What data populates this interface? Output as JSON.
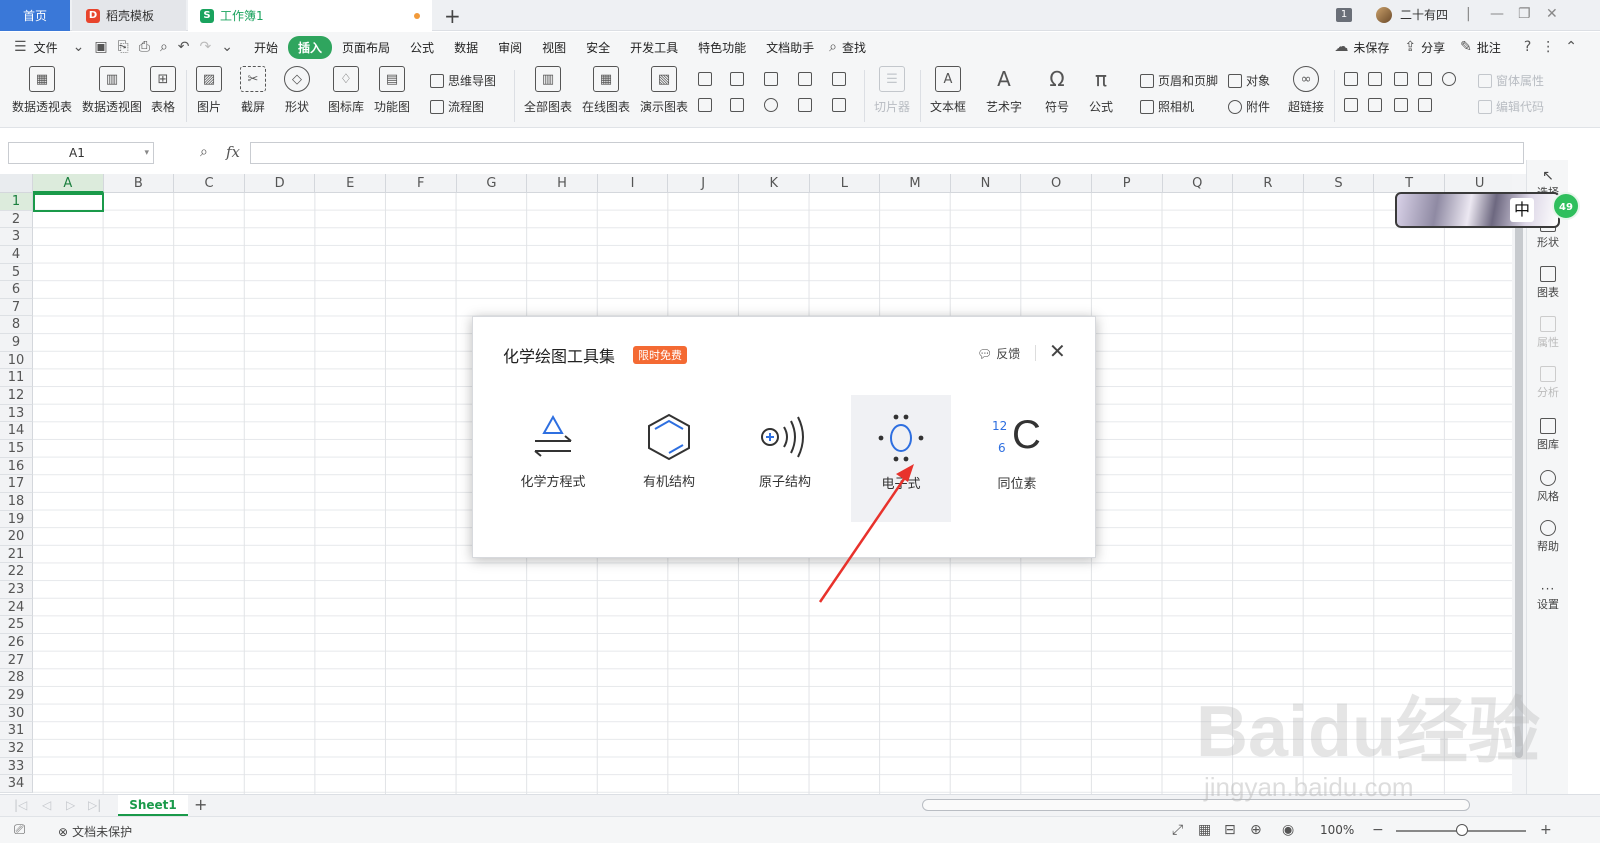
{
  "tabs": {
    "home": "首页",
    "template": "稻壳模板",
    "workbook": "工作簿1",
    "new_tab": "+"
  },
  "titlebar": {
    "count": "1",
    "user": "二十有四"
  },
  "menu": {
    "file": "文件",
    "items": [
      "开始",
      "插入",
      "页面布局",
      "公式",
      "数据",
      "审阅",
      "视图",
      "安全",
      "开发工具",
      "特色功能",
      "文档助手"
    ],
    "active": "插入",
    "search": "查找",
    "unsaved": "未保存",
    "share": "分享",
    "comment": "批注"
  },
  "ribbon": {
    "pivot_table": "数据透视表",
    "pivot_chart": "数据透视图",
    "table": "表格",
    "picture": "图片",
    "screenshot": "截屏",
    "shape": "形状",
    "icon_lib": "图标库",
    "func_chart": "功能图",
    "mind_map": "思维导图",
    "flow_chart": "流程图",
    "all_charts": "全部图表",
    "online_chart": "在线图表",
    "demo_chart": "演示图表",
    "slicer": "切片器",
    "textbox": "文本框",
    "wordart": "艺术字",
    "symbol": "符号",
    "formula": "公式",
    "header_footer": "页眉和页脚",
    "object": "对象",
    "camera": "照相机",
    "attachment": "附件",
    "hyperlink": "超链接",
    "form_props": "窗体属性",
    "edit_code": "编辑代码"
  },
  "formula_bar": {
    "cell_ref": "A1",
    "fx": "fx",
    "value": ""
  },
  "grid": {
    "columns": [
      "A",
      "B",
      "C",
      "D",
      "E",
      "F",
      "G",
      "H",
      "I",
      "J",
      "K",
      "L",
      "M",
      "N",
      "O",
      "P",
      "Q",
      "R",
      "S",
      "T",
      "U"
    ],
    "rows": [
      "1",
      "2",
      "3",
      "4",
      "5",
      "6",
      "7",
      "8",
      "9",
      "10",
      "11",
      "12",
      "13",
      "14",
      "15",
      "16",
      "17",
      "18",
      "19",
      "20",
      "21",
      "22",
      "23",
      "24",
      "25",
      "26",
      "27",
      "28",
      "29",
      "30",
      "31",
      "32",
      "33",
      "34"
    ],
    "selected_cell": "A1"
  },
  "right_panel": {
    "select": "选择",
    "shape": "形状",
    "chart": "图表",
    "property": "属性",
    "analysis": "分析",
    "gallery": "图库",
    "style": "风格",
    "help": "帮助",
    "settings": "设置"
  },
  "ime": {
    "char": "中",
    "badge": "49"
  },
  "dialog": {
    "title": "化学绘图工具集",
    "badge": "限时免费",
    "feedback": "反馈",
    "tools": [
      {
        "label": "化学方程式",
        "icon": "chemical-equation-icon"
      },
      {
        "label": "有机结构",
        "icon": "benzene-ring-icon"
      },
      {
        "label": "原子结构",
        "icon": "atom-structure-icon"
      },
      {
        "label": "电子式",
        "icon": "electron-formula-icon"
      },
      {
        "label": "同位素",
        "icon": "isotope-icon"
      }
    ],
    "highlighted": "电子式",
    "isotope_mass": "12",
    "isotope_number": "6",
    "isotope_symbol": "C"
  },
  "sheet_tabs": {
    "sheet1": "Sheet1",
    "add": "+"
  },
  "statusbar": {
    "protection": "文档未保护",
    "zoom": "100%"
  },
  "watermark": {
    "brand": "Baidu经验",
    "url": "jingyan.baidu.com"
  },
  "colors": {
    "accent_green": "#1a9a4a",
    "home_tab_blue": "#3a78d8",
    "badge_orange": "#f46a33",
    "annotation_red": "#e8322c"
  }
}
